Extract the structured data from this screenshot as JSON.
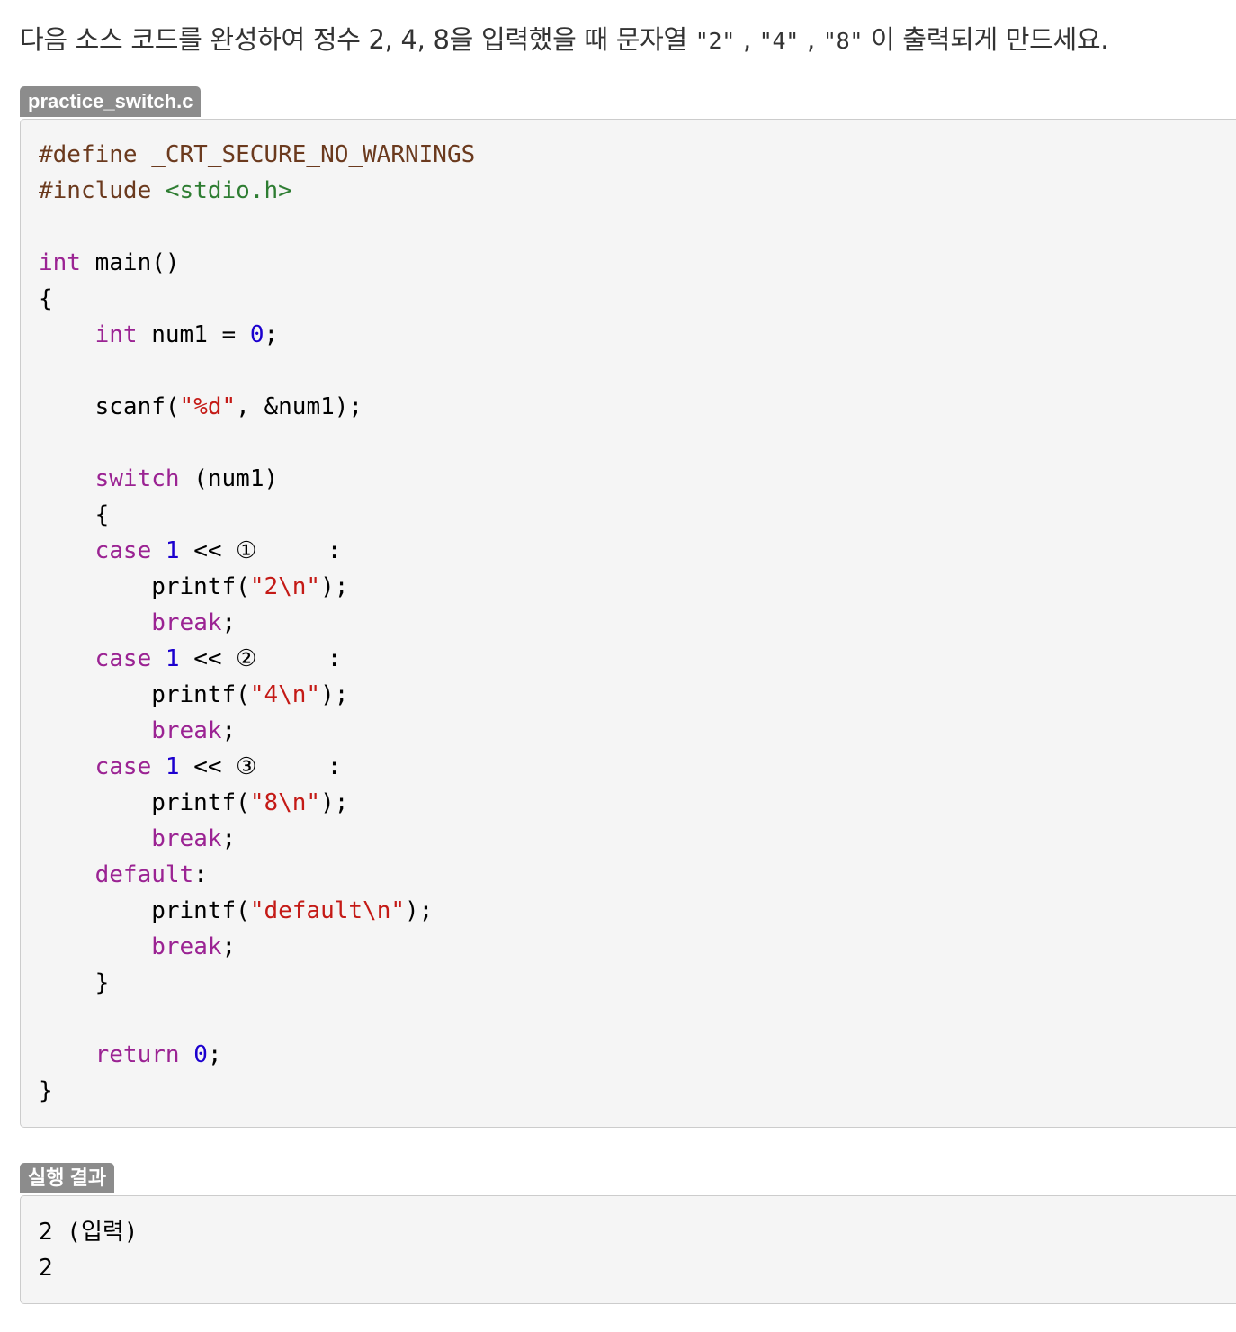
{
  "question": {
    "part1": "다음 소스 코드를 완성하여 정수 2, 4, 8을 입력했을 때 문자열 ",
    "code1": "\"2\"",
    "sep1": " , ",
    "code2": "\"4\"",
    "sep2": " , ",
    "code3": "\"8\"",
    "part2": " 이 출력되게 만드세요."
  },
  "source_file": {
    "filename": "practice_switch.c",
    "lines": [
      [
        {
          "t": "#define _CRT_SECURE_NO_WARNINGS",
          "c": "pp"
        }
      ],
      [
        {
          "t": "#include ",
          "c": "pp"
        },
        {
          "t": "<stdio.h>",
          "c": "inc"
        }
      ],
      [],
      [
        {
          "t": "int",
          "c": "kw"
        },
        {
          "t": " main()",
          "c": ""
        }
      ],
      [
        {
          "t": "{",
          "c": ""
        }
      ],
      [
        {
          "t": "    ",
          "c": ""
        },
        {
          "t": "int",
          "c": "kw"
        },
        {
          "t": " num1 = ",
          "c": ""
        },
        {
          "t": "0",
          "c": "num"
        },
        {
          "t": ";",
          "c": ""
        }
      ],
      [],
      [
        {
          "t": "    scanf(",
          "c": ""
        },
        {
          "t": "\"%d\"",
          "c": "str"
        },
        {
          "t": ", &num1);",
          "c": ""
        }
      ],
      [],
      [
        {
          "t": "    ",
          "c": ""
        },
        {
          "t": "switch",
          "c": "kw"
        },
        {
          "t": " (num1)",
          "c": ""
        }
      ],
      [
        {
          "t": "    {",
          "c": ""
        }
      ],
      [
        {
          "t": "    ",
          "c": ""
        },
        {
          "t": "case",
          "c": "kw"
        },
        {
          "t": " ",
          "c": ""
        },
        {
          "t": "1",
          "c": "num"
        },
        {
          "t": " << ①_____:",
          "c": ""
        }
      ],
      [
        {
          "t": "        printf(",
          "c": ""
        },
        {
          "t": "\"2\\n\"",
          "c": "str"
        },
        {
          "t": ");",
          "c": ""
        }
      ],
      [
        {
          "t": "        ",
          "c": ""
        },
        {
          "t": "break",
          "c": "kw"
        },
        {
          "t": ";",
          "c": ""
        }
      ],
      [
        {
          "t": "    ",
          "c": ""
        },
        {
          "t": "case",
          "c": "kw"
        },
        {
          "t": " ",
          "c": ""
        },
        {
          "t": "1",
          "c": "num"
        },
        {
          "t": " << ②_____:",
          "c": ""
        }
      ],
      [
        {
          "t": "        printf(",
          "c": ""
        },
        {
          "t": "\"4\\n\"",
          "c": "str"
        },
        {
          "t": ");",
          "c": ""
        }
      ],
      [
        {
          "t": "        ",
          "c": ""
        },
        {
          "t": "break",
          "c": "kw"
        },
        {
          "t": ";",
          "c": ""
        }
      ],
      [
        {
          "t": "    ",
          "c": ""
        },
        {
          "t": "case",
          "c": "kw"
        },
        {
          "t": " ",
          "c": ""
        },
        {
          "t": "1",
          "c": "num"
        },
        {
          "t": " << ③_____:",
          "c": ""
        }
      ],
      [
        {
          "t": "        printf(",
          "c": ""
        },
        {
          "t": "\"8\\n\"",
          "c": "str"
        },
        {
          "t": ");",
          "c": ""
        }
      ],
      [
        {
          "t": "        ",
          "c": ""
        },
        {
          "t": "break",
          "c": "kw"
        },
        {
          "t": ";",
          "c": ""
        }
      ],
      [
        {
          "t": "    ",
          "c": ""
        },
        {
          "t": "default",
          "c": "kw"
        },
        {
          "t": ":",
          "c": ""
        }
      ],
      [
        {
          "t": "        printf(",
          "c": ""
        },
        {
          "t": "\"default\\n\"",
          "c": "str"
        },
        {
          "t": ");",
          "c": ""
        }
      ],
      [
        {
          "t": "        ",
          "c": ""
        },
        {
          "t": "break",
          "c": "kw"
        },
        {
          "t": ";",
          "c": ""
        }
      ],
      [
        {
          "t": "    }",
          "c": ""
        }
      ],
      [],
      [
        {
          "t": "    ",
          "c": ""
        },
        {
          "t": "return",
          "c": "kw"
        },
        {
          "t": " ",
          "c": ""
        },
        {
          "t": "0",
          "c": "num"
        },
        {
          "t": ";",
          "c": ""
        }
      ],
      [
        {
          "t": "}",
          "c": ""
        }
      ]
    ]
  },
  "result": {
    "label": "실행 결과",
    "lines": [
      "2 (입력)",
      "2"
    ]
  },
  "colors": {
    "keyword": "#9b2393",
    "number": "#1c00cf",
    "string": "#c41a16",
    "preprocessor": "#6b3a1e",
    "include": "#2e7d32",
    "tag_background": "#8c8c8c",
    "box_background": "#f5f5f5"
  }
}
